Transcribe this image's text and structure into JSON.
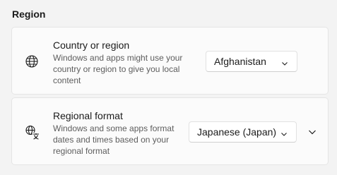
{
  "section": {
    "title": "Region"
  },
  "country": {
    "title": "Country or region",
    "description": "Windows and apps might use your country or region to give you local content",
    "icon": "globe-icon",
    "selected": "Afghanistan"
  },
  "format": {
    "title": "Regional format",
    "description": "Windows and some apps format dates and times based on your regional format",
    "icon": "language-icon",
    "selected": "Japanese (Japan)",
    "expand_icon": "chevron-down-icon"
  }
}
